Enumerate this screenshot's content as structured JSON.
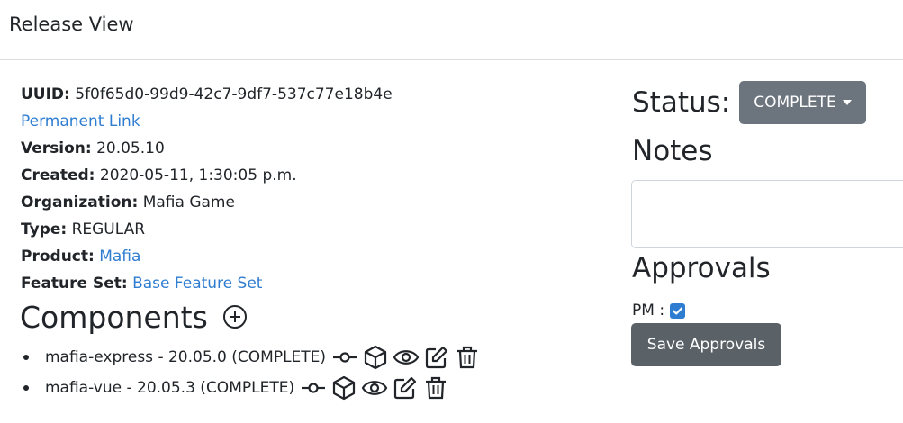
{
  "header": {
    "title": "Release View"
  },
  "info": {
    "uuid_label": "UUID:",
    "uuid_value": "5f0f65d0-99d9-42c7-9df7-537c77e18b4e",
    "permanent_link": "Permanent Link",
    "version_label": "Version:",
    "version_value": "20.05.10",
    "created_label": "Created:",
    "created_value": "2020-05-11, 1:30:05 p.m.",
    "organization_label": "Organization:",
    "organization_value": "Mafia Game",
    "type_label": "Type:",
    "type_value": "REGULAR",
    "product_label": "Product:",
    "product_value": "Mafia",
    "feature_set_label": "Feature Set:",
    "feature_set_value": "Base Feature Set"
  },
  "components": {
    "title": "Components",
    "items": [
      {
        "text": "mafia-express - 20.05.0 (COMPLETE)"
      },
      {
        "text": "mafia-vue - 20.05.3 (COMPLETE)"
      }
    ],
    "icons": [
      "commit-icon",
      "package-icon",
      "eye-icon",
      "edit-icon",
      "trash-icon"
    ]
  },
  "status": {
    "label": "Status:",
    "value": "COMPLETE"
  },
  "notes": {
    "title": "Notes",
    "value": ""
  },
  "approvals": {
    "title": "Approvals",
    "items": [
      {
        "label": "PM :",
        "checked": true
      }
    ],
    "save_label": "Save Approvals"
  },
  "colors": {
    "link": "#2f7dd1",
    "status_button": "#6c757d",
    "save_button": "#5a6268",
    "checkbox": "#2f7dd1"
  }
}
